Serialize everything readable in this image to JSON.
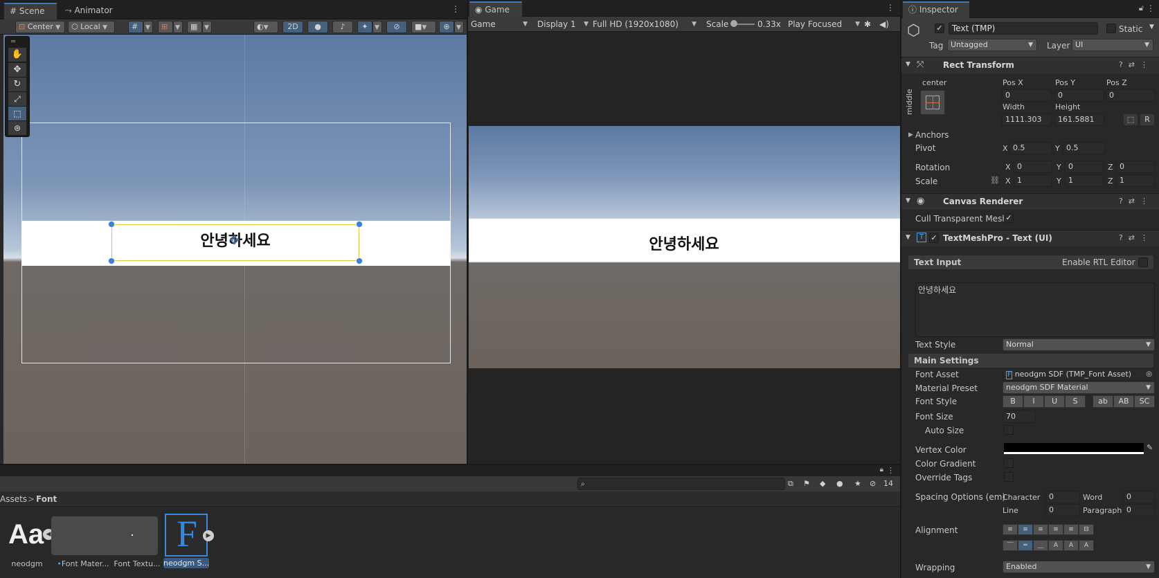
{
  "scene": {
    "tabs": [
      {
        "label": "Scene"
      },
      {
        "label": "Animator"
      }
    ],
    "toolbar": {
      "pivot": "Center",
      "space": "Local",
      "mode_2d": "2D"
    },
    "canvas_text": "안녕하세요"
  },
  "game": {
    "tab": "Game",
    "toolbar": {
      "view": "Game",
      "display": "Display 1",
      "resolution": "Full HD (1920x1080)",
      "scale_label": "Scale",
      "scale_value": "0.33x",
      "play_mode": "Play Focused"
    },
    "canvas_text": "안녕하세요"
  },
  "inspector": {
    "tab": "Inspector",
    "object_name": "Text (TMP)",
    "static_label": "Static",
    "tag_label": "Tag",
    "tag_value": "Untagged",
    "layer_label": "Layer",
    "layer_value": "UI",
    "rect_transform": {
      "title": "Rect Transform",
      "anchor_h": "center",
      "anchor_v": "middle",
      "pos_x_label": "Pos X",
      "pos_x": "0",
      "pos_y_label": "Pos Y",
      "pos_y": "0",
      "pos_z_label": "Pos Z",
      "pos_z": "0",
      "width_label": "Width",
      "width": "1111.303",
      "height_label": "Height",
      "height": "161.5881",
      "r_label": "R",
      "anchors_label": "Anchors",
      "pivot_label": "Pivot",
      "pivot_x": "0.5",
      "pivot_y": "0.5",
      "rotation_label": "Rotation",
      "rot_x": "0",
      "rot_y": "0",
      "rot_z": "0",
      "scale_label": "Scale",
      "scale_x": "1",
      "scale_y": "1",
      "scale_z": "1",
      "x_label": "X",
      "y_label": "Y",
      "z_label": "Z"
    },
    "canvas_renderer": {
      "title": "Canvas Renderer",
      "cull_label": "Cull Transparent Mesh"
    },
    "tmp": {
      "title": "TextMeshPro - Text (UI)",
      "text_input_label": "Text Input",
      "rtl_label": "Enable RTL Editor",
      "text_value": "안녕하세요",
      "text_style_label": "Text Style",
      "text_style_value": "Normal",
      "main_settings_label": "Main Settings",
      "font_asset_label": "Font Asset",
      "font_asset_value": "neodgm SDF (TMP_Font Asset)",
      "material_preset_label": "Material Preset",
      "material_preset_value": "neodgm SDF Material",
      "font_style_label": "Font Style",
      "font_style_buttons": [
        "B",
        "I",
        "U",
        "S",
        "ab",
        "AB",
        "SC"
      ],
      "font_size_label": "Font Size",
      "font_size_value": "70",
      "auto_size_label": "Auto Size",
      "vertex_color_label": "Vertex Color",
      "vertex_color": "#000000",
      "color_gradient_label": "Color Gradient",
      "override_tags_label": "Override Tags",
      "spacing_label": "Spacing Options (em)",
      "character_label": "Character",
      "character_value": "0",
      "word_label": "Word",
      "word_value": "0",
      "line_label": "Line",
      "line_value": "0",
      "paragraph_label": "Paragraph",
      "paragraph_value": "0",
      "alignment_label": "Alignment",
      "wrapping_label": "Wrapping",
      "wrapping_value": "Enabled"
    }
  },
  "project": {
    "breadcrumb_root": "Assets",
    "breadcrumb_sep": ">",
    "breadcrumb_current": "Font",
    "hidden_count": "14",
    "assets": [
      {
        "label": "neodgm"
      },
      {
        "label": "Font Mater..."
      },
      {
        "label": "Font Textu..."
      },
      {
        "label": "neodgm S..."
      }
    ]
  },
  "colors": {
    "accent": "#3a79bb",
    "selection": "#46607c",
    "rect_handle": "#3b82d6",
    "text_rect": "#e3c540"
  }
}
